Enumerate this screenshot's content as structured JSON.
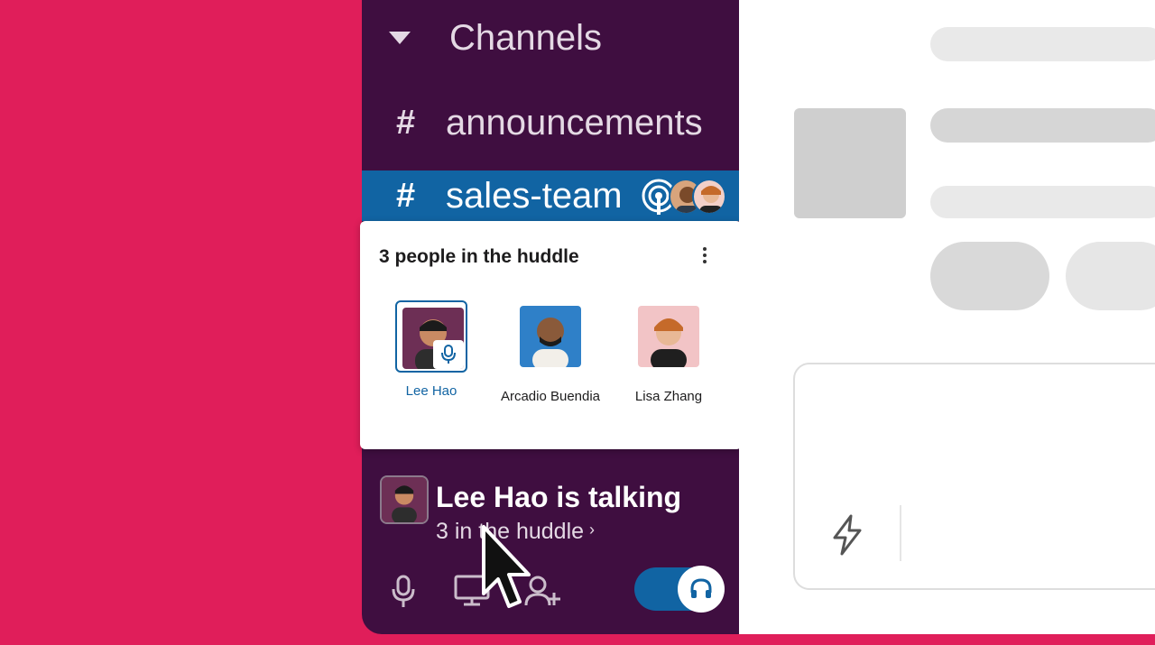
{
  "sidebar": {
    "channels_title": "Channels",
    "channels": [
      {
        "hash": "#",
        "name": "announcements"
      },
      {
        "hash": "#",
        "name": "sales-team"
      }
    ]
  },
  "huddle": {
    "title": "3 people in the huddle",
    "people": [
      {
        "name": "Lee Hao"
      },
      {
        "name": "Arcadio Buendia"
      },
      {
        "name": "Lisa Zhang"
      }
    ],
    "talk_title": "Lee Hao is talking",
    "talk_sub": "3 in the huddle",
    "chevron": "›"
  },
  "colors": {
    "page_bg": "#E01E5A",
    "sidebar_bg": "#3F0E40",
    "active_channel": "#1164A3",
    "link_blue": "#1164A3"
  }
}
